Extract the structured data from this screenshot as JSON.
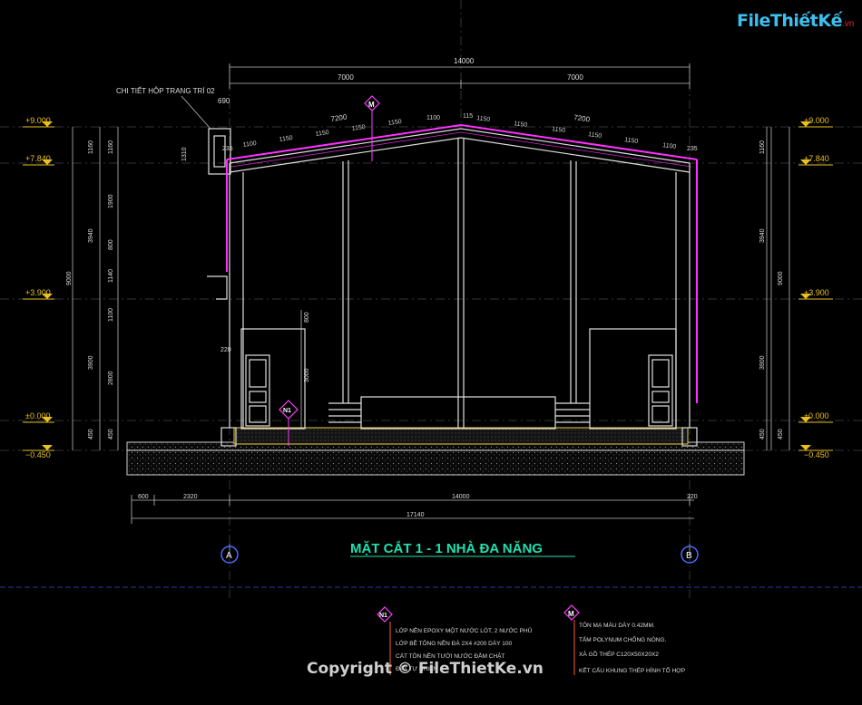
{
  "logo": {
    "text": "FileThiếtKế",
    "sub": ".vn"
  },
  "title": "MẶT CẮT 1 - 1 NHÀ ĐA NĂNG",
  "detail_label": "CHI TIẾT HỘP TRANG TRÍ 02",
  "copyright": "Copyright © FileThietKe.vn",
  "levels": {
    "l9000": "+9.000",
    "l7840": "+7.840",
    "l3900": "+3.900",
    "l0000": "±0.000",
    "lm450": "−0.450"
  },
  "axes": {
    "a": "A",
    "b": "B"
  },
  "markers": {
    "m": "M",
    "n1": "N1"
  },
  "top_dims": {
    "total": "14000",
    "half_left": "7000",
    "half_right": "7000",
    "roof_left": "7200",
    "roof_right": "7200",
    "box": "690",
    "edge_left": "235",
    "edge_right": "235",
    "seg_1150": "1150",
    "seg_1100": "1100",
    "seg_115": "115"
  },
  "left_dims": {
    "d1160": "1160",
    "d1900": "1900",
    "d800": "800",
    "d1140": "1140",
    "d1100": "1100",
    "d2800": "2800",
    "d450": "450",
    "d3940": "3940",
    "d3900": "3900",
    "d9000": "9000",
    "d1310": "1310",
    "d220": "220"
  },
  "right_dims": {
    "d1160": "1160",
    "d3940": "3940",
    "d3900": "3900",
    "d9000": "9000",
    "d450": "450"
  },
  "inner_dims": {
    "d800": "800",
    "d3000": "3000"
  },
  "bottom_dims": {
    "d600": "600",
    "d2320": "2320",
    "d14000": "14000",
    "d220": "220",
    "d17140": "17140"
  },
  "legend_n1": [
    "LỚP NỀN EPOXY MỘT NƯỚC LÓT, 2 NƯỚC PHỦ",
    "LỚP BÊ TÔNG NỀN ĐÁ 2X4 #200 DÀY 100",
    "CÁT TÔN NỀN TƯỚI NƯỚC ĐẦM CHẶT",
    "ĐẤT TỰ NHIÊN"
  ],
  "legend_m": [
    "TÔN MẠ MÀU DÀY 0.42MM.",
    "TẤM POLYNUM CHỐNG NÓNG.",
    "XÀ GỒ THÉP C120X50X20X2",
    "KẾT CẤU KHUNG THÉP HÌNH TỔ HỢP"
  ],
  "colors": {
    "dim": "#d8d8d8",
    "level": "#e8c020",
    "roof": "#ff30ff",
    "title": "#20e0b0",
    "grid": "#3a3a3a",
    "axis_circle": "#4a6cff",
    "marker": "#ff40ff"
  }
}
